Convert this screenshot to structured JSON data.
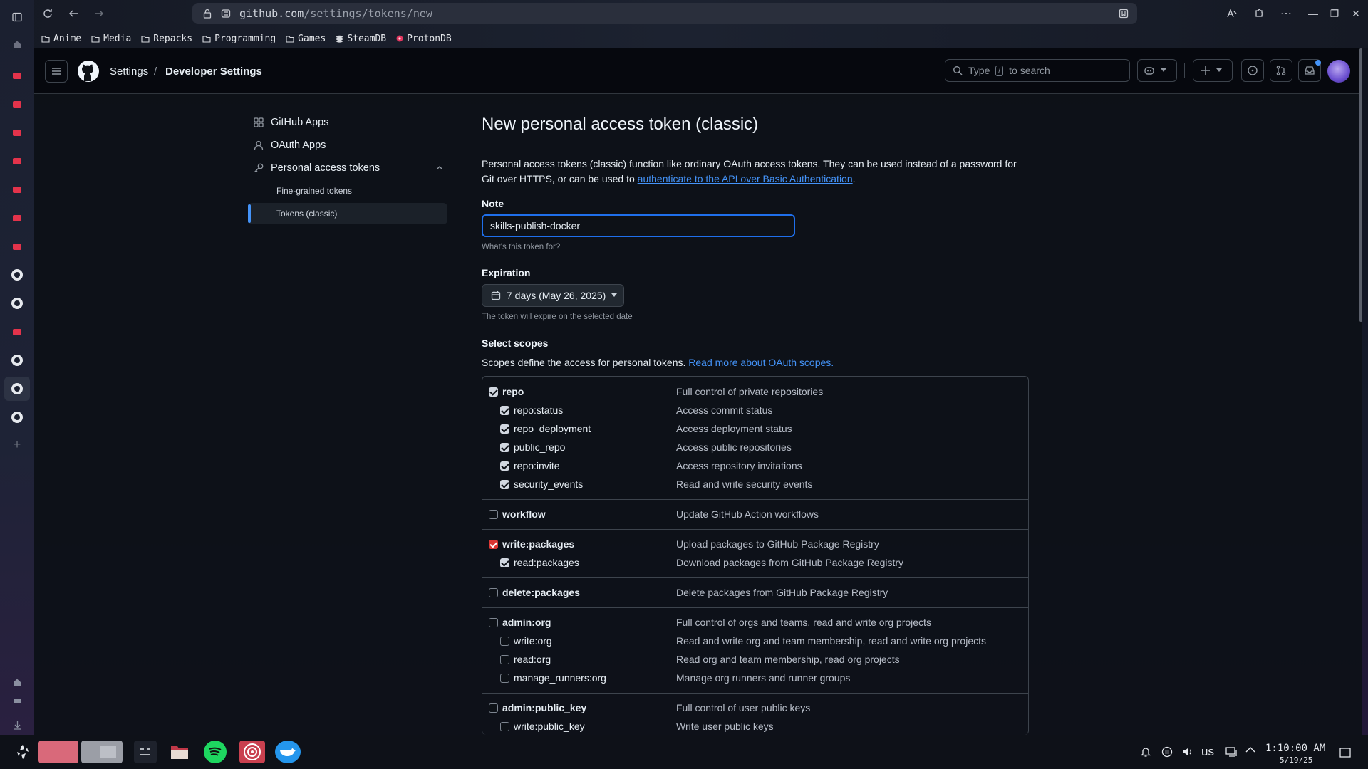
{
  "browser": {
    "url_host": "github.com",
    "url_path": "/settings/tokens/new",
    "bookmarks": [
      "Anime",
      "Media",
      "Repacks",
      "Programming",
      "Games",
      "SteamDB",
      "ProtonDB"
    ]
  },
  "header": {
    "breadcrumb_settings": "Settings",
    "breadcrumb_sep": "/",
    "breadcrumb_developer": "Developer Settings",
    "search_type": "Type",
    "search_key": "/",
    "search_rest": "to search"
  },
  "sidebar": {
    "items": [
      {
        "label": "GitHub Apps",
        "icon": "apps-icon"
      },
      {
        "label": "OAuth Apps",
        "icon": "person-icon"
      },
      {
        "label": "Personal access tokens",
        "icon": "key-icon"
      }
    ],
    "subitems": [
      "Fine-grained tokens",
      "Tokens (classic)"
    ]
  },
  "main": {
    "title": "New personal access token (classic)",
    "intro": "Personal access tokens (classic) function like ordinary OAuth access tokens. They can be used instead of a password for Git over HTTPS, or can be used to ",
    "intro_link": "authenticate to the API over Basic Authentication",
    "intro_end": ".",
    "note_label": "Note",
    "note_value": "skills-publish-docker",
    "note_help": "What's this token for?",
    "expiration_label": "Expiration",
    "expiration_value": "7 days (May 26, 2025)",
    "expiration_help": "The token will expire on the selected date",
    "scopes_label": "Select scopes",
    "scopes_desc": "Scopes define the access for personal tokens. ",
    "scopes_link": "Read more about OAuth scopes."
  },
  "scopes": [
    {
      "name": "repo",
      "desc": "Full control of private repositories",
      "state": "on",
      "top": true
    },
    {
      "name": "repo:status",
      "desc": "Access commit status",
      "state": "on",
      "top": false
    },
    {
      "name": "repo_deployment",
      "desc": "Access deployment status",
      "state": "on",
      "top": false
    },
    {
      "name": "public_repo",
      "desc": "Access public repositories",
      "state": "on",
      "top": false
    },
    {
      "name": "repo:invite",
      "desc": "Access repository invitations",
      "state": "on",
      "top": false
    },
    {
      "name": "security_events",
      "desc": "Read and write security events",
      "state": "on",
      "top": false
    },
    {
      "name": "workflow",
      "desc": "Update GitHub Action workflows",
      "state": "off",
      "top": true
    },
    {
      "name": "write:packages",
      "desc": "Upload packages to GitHub Package Registry",
      "state": "red",
      "top": true
    },
    {
      "name": "read:packages",
      "desc": "Download packages from GitHub Package Registry",
      "state": "on",
      "top": false
    },
    {
      "name": "delete:packages",
      "desc": "Delete packages from GitHub Package Registry",
      "state": "off",
      "top": true
    },
    {
      "name": "admin:org",
      "desc": "Full control of orgs and teams, read and write org projects",
      "state": "off",
      "top": true
    },
    {
      "name": "write:org",
      "desc": "Read and write org and team membership, read and write org projects",
      "state": "off",
      "top": false
    },
    {
      "name": "read:org",
      "desc": "Read org and team membership, read org projects",
      "state": "off",
      "top": false
    },
    {
      "name": "manage_runners:org",
      "desc": "Manage org runners and runner groups",
      "state": "off",
      "top": false
    },
    {
      "name": "admin:public_key",
      "desc": "Full control of user public keys",
      "state": "off",
      "top": true
    },
    {
      "name": "write:public_key",
      "desc": "Write user public keys",
      "state": "off",
      "top": false
    }
  ],
  "taskbar": {
    "lang": "us",
    "time": "1:10:00 AM",
    "date": "5/19/25"
  },
  "colors": {
    "accent": "#4493f8",
    "checked_red": "#da3633",
    "focus": "#1f6feb"
  }
}
